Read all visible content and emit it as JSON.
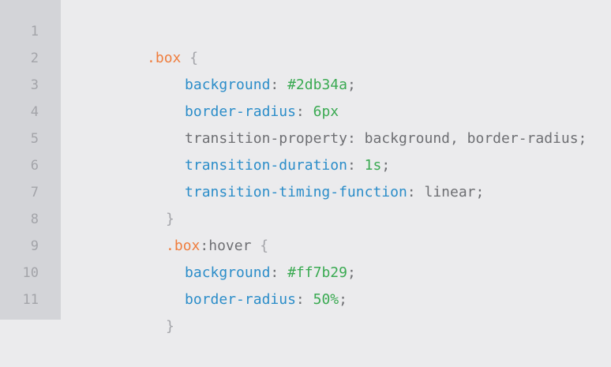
{
  "line_numbers": [
    "1",
    "2",
    "3",
    "4",
    "5",
    "6",
    "7",
    "8",
    "9",
    "10",
    "11"
  ],
  "code": {
    "l1": {
      "selector": ".box",
      "brace": "{"
    },
    "l2": {
      "prop": "background",
      "colon": ":",
      "value": "#2db34a",
      "semi": ";"
    },
    "l3": {
      "prop": "border-radius",
      "colon": ":",
      "value": "6px"
    },
    "l4": {
      "prop": "transition-property",
      "colon": ":",
      "value": "background, border-radius;"
    },
    "l5": {
      "prop": "transition-duration",
      "colon": ":",
      "value": "1s",
      "semi": ";"
    },
    "l6": {
      "prop": "transition-timing-function",
      "colon": ":",
      "value": "linear;"
    },
    "l7": {
      "brace": "}"
    },
    "l8": {
      "selector": ".box",
      "pseudo": ":hover",
      "brace": "{"
    },
    "l9": {
      "prop": "background",
      "colon": ":",
      "value": "#ff7b29",
      "semi": ";"
    },
    "l10": {
      "prop": "border-radius",
      "colon": ":",
      "value": "50%",
      "semi": ";"
    },
    "l11": {
      "brace": "}"
    }
  },
  "colors": {
    "selector": "#ef7d3d",
    "property": "#2b8dc9",
    "literal": "#3aaa52",
    "text": "#6e6f73",
    "gutter_bg": "#d3d4d8",
    "editor_bg": "#ebebed"
  }
}
